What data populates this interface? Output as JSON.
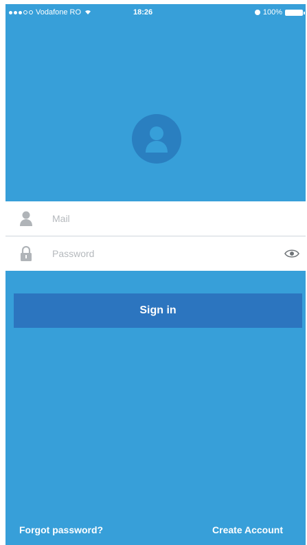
{
  "status_bar": {
    "carrier": "Vodafone RO",
    "time": "18:26",
    "battery": "100%"
  },
  "form": {
    "mail_placeholder": "Mail",
    "password_placeholder": "Password"
  },
  "actions": {
    "sign_in_label": "Sign in",
    "forgot_password_label": "Forgot password?",
    "create_account_label": "Create Account"
  },
  "icons": {
    "avatar": "user-icon",
    "mail_field": "user-icon",
    "password_field": "lock-icon",
    "toggle_visibility": "eye-icon"
  },
  "colors": {
    "background": "#379fd9",
    "avatar": "#2a7fc0",
    "sign_in_button": "#2c75bf"
  }
}
